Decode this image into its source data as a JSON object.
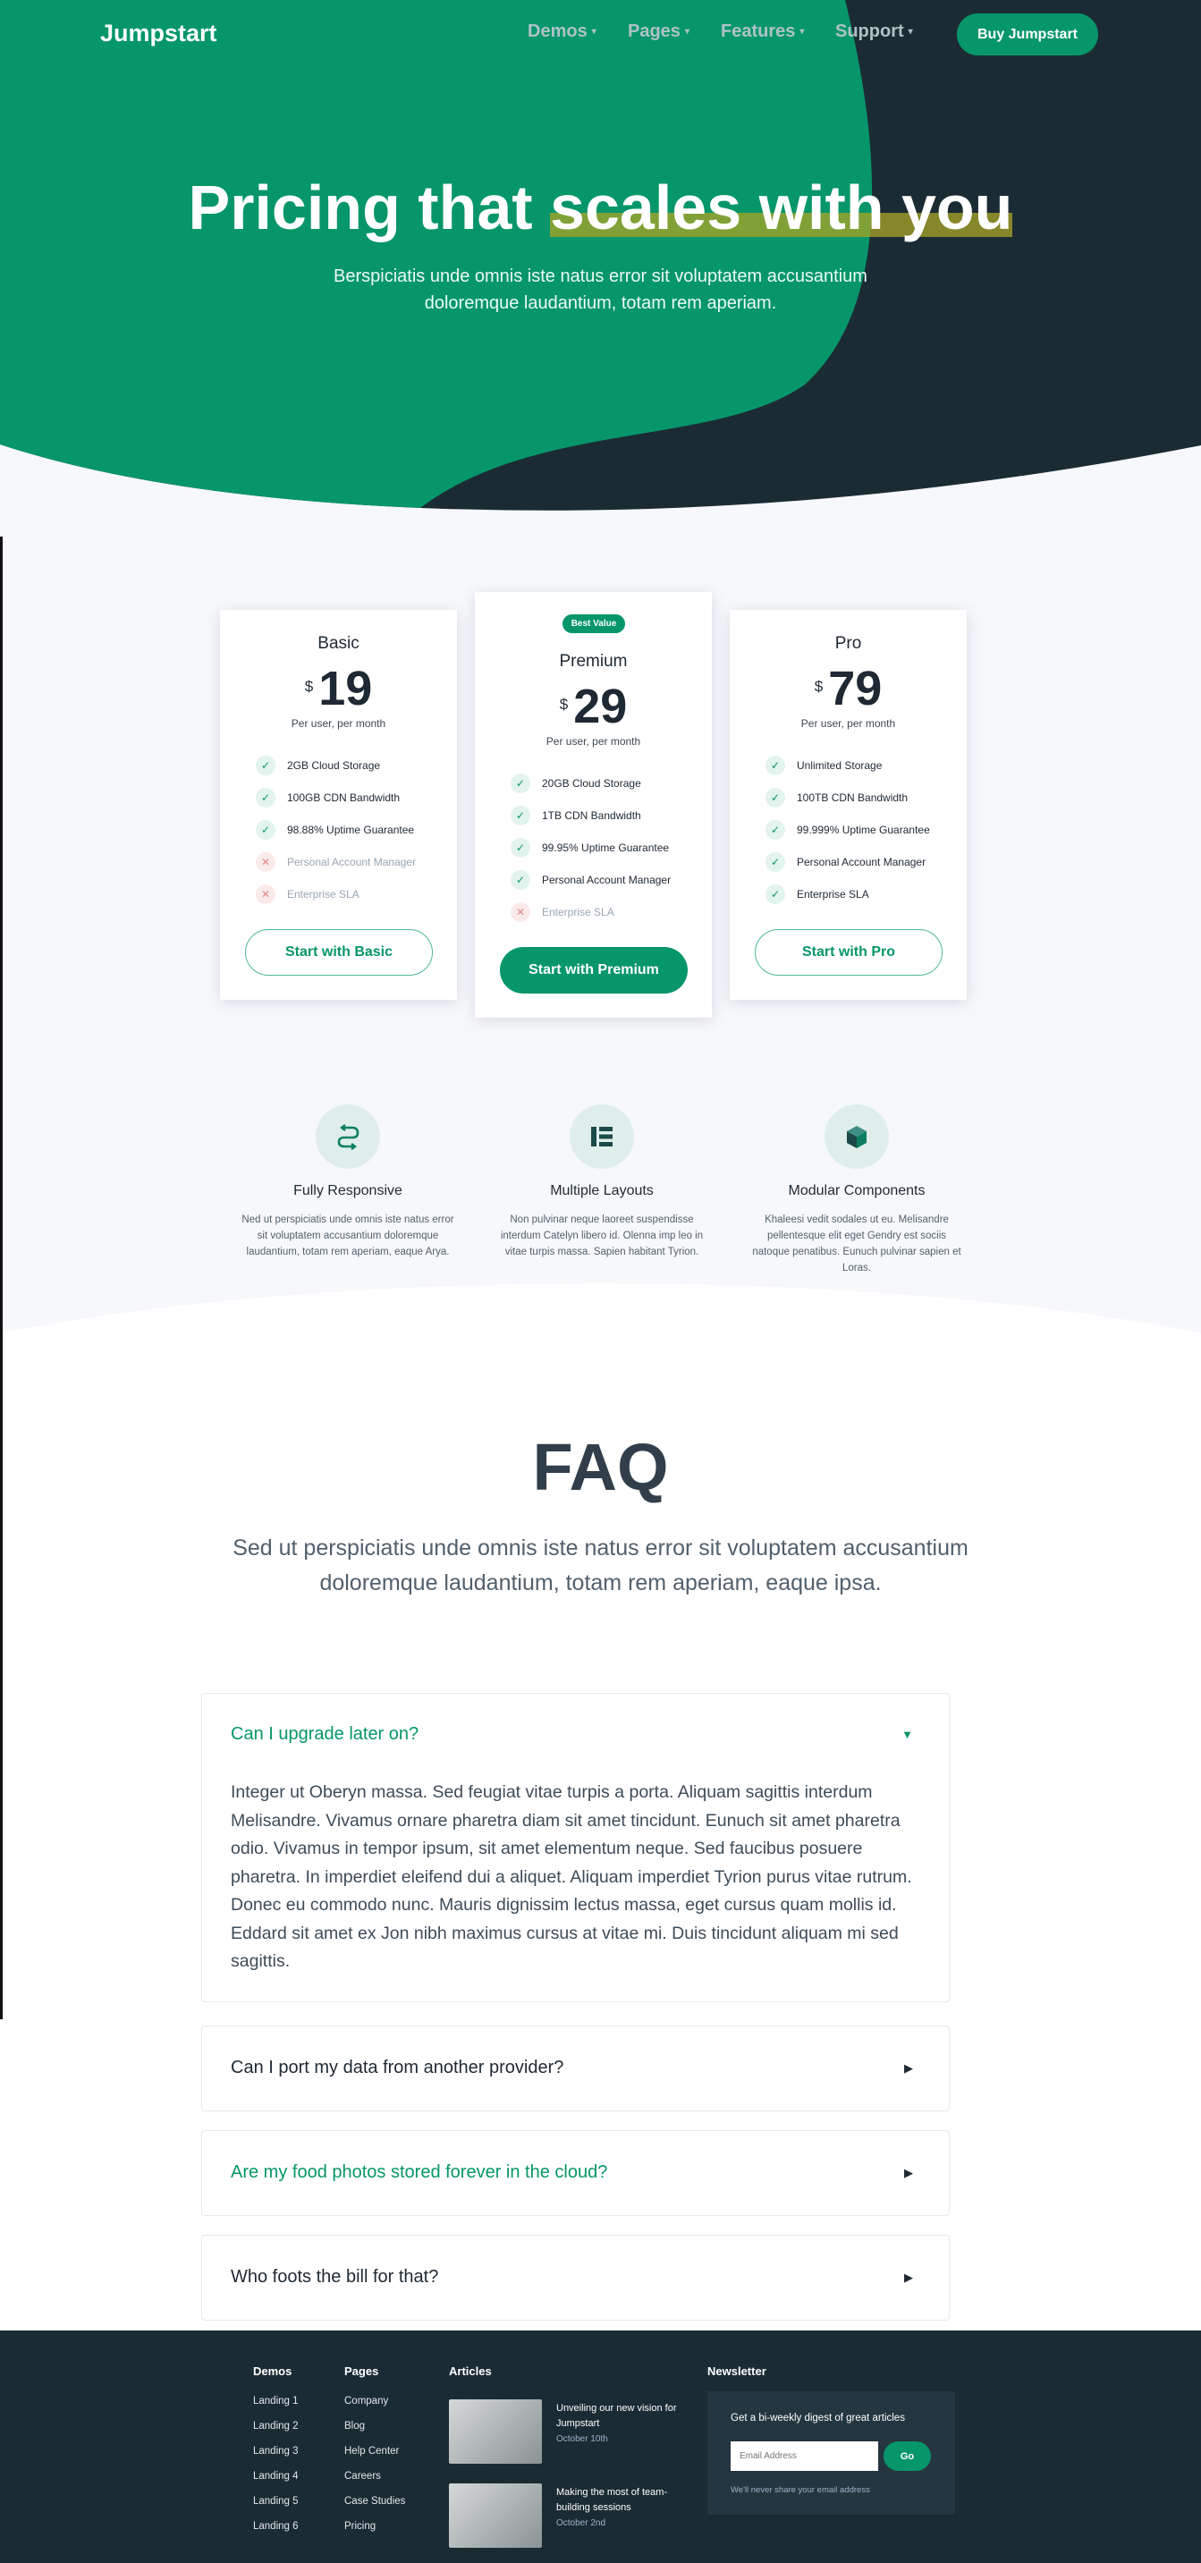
{
  "brand": {
    "logo": "Jumpstart",
    "accent": "#069669",
    "dark": "#1b2b34"
  },
  "nav": {
    "items": [
      {
        "label": "Demos",
        "caret": "▾"
      },
      {
        "label": "Pages",
        "caret": "▾"
      },
      {
        "label": "Features",
        "caret": "▾"
      },
      {
        "label": "Support",
        "caret": "▾"
      }
    ],
    "cta": "Buy Jumpstart"
  },
  "hero": {
    "title_part1": "Pricing that ",
    "title_highlight": "scales with you",
    "subtitle": "Berspiciatis unde omnis iste natus error sit voluptatem accusantium doloremque laudantium, totam rem aperiam."
  },
  "plans": [
    {
      "name": "Basic",
      "currency": "$",
      "price": "19",
      "period": "Per user, per month",
      "features": [
        {
          "text": "2GB Cloud Storage",
          "included": true,
          "icon": "check-icon",
          "mark": "✓"
        },
        {
          "text": "100GB CDN Bandwidth",
          "included": true,
          "icon": "check-icon",
          "mark": "✓"
        },
        {
          "text": "98.88% Uptime Guarantee",
          "included": true,
          "icon": "check-icon",
          "mark": "✓"
        },
        {
          "text": "Personal Account Manager",
          "included": false,
          "icon": "x-icon",
          "mark": "✕"
        },
        {
          "text": "Enterprise SLA",
          "included": false,
          "icon": "x-icon",
          "mark": "✕"
        }
      ],
      "cta": "Start with Basic"
    },
    {
      "name": "Premium",
      "badge": "Best Value",
      "currency": "$",
      "price": "29",
      "period": "Per user, per month",
      "features": [
        {
          "text": "20GB Cloud Storage",
          "included": true,
          "icon": "check-icon",
          "mark": "✓"
        },
        {
          "text": "1TB CDN Bandwidth",
          "included": true,
          "icon": "check-icon",
          "mark": "✓"
        },
        {
          "text": "99.95% Uptime Guarantee",
          "included": true,
          "icon": "check-icon",
          "mark": "✓"
        },
        {
          "text": "Personal Account Manager",
          "included": true,
          "icon": "check-icon",
          "mark": "✓"
        },
        {
          "text": "Enterprise SLA",
          "included": false,
          "icon": "x-icon",
          "mark": "✕"
        }
      ],
      "cta": "Start with Premium"
    },
    {
      "name": "Pro",
      "currency": "$",
      "price": "79",
      "period": "Per user, per month",
      "features": [
        {
          "text": "Unlimited Storage",
          "included": true,
          "icon": "check-icon",
          "mark": "✓"
        },
        {
          "text": "100TB CDN Bandwidth",
          "included": true,
          "icon": "check-icon",
          "mark": "✓"
        },
        {
          "text": "99.999% Uptime Guarantee",
          "included": true,
          "icon": "check-icon",
          "mark": "✓"
        },
        {
          "text": "Personal Account Manager",
          "included": true,
          "icon": "check-icon",
          "mark": "✓"
        },
        {
          "text": "Enterprise SLA",
          "included": true,
          "icon": "check-icon",
          "mark": "✓"
        }
      ],
      "cta": "Start with Pro"
    }
  ],
  "features": [
    {
      "icon": "responsive-icon",
      "title": "Fully Responsive",
      "text": "Ned ut perspiciatis unde omnis iste natus error sit voluptatem accusantium doloremque laudantium, totam rem aperiam, eaque Arya."
    },
    {
      "icon": "layouts-icon",
      "title": "Multiple Layouts",
      "text": "Non pulvinar neque laoreet suspendisse interdum Catelyn libero id. Olenna imp leo in vitae turpis massa. Sapien habitant Tyrion."
    },
    {
      "icon": "cube-icon",
      "title": "Modular Components",
      "text": "Khaleesi vedit sodales ut eu. Melisandre pellentesque elit eget Gendry est sociis natoque penatibus. Eunuch pulvinar sapien et Loras."
    }
  ],
  "faq": {
    "title": "FAQ",
    "subtitle": "Sed ut perspiciatis unde omnis iste natus error sit voluptatem accusantium doloremque laudantium, totam rem aperiam, eaque ipsa.",
    "items": [
      {
        "q": "Can I upgrade later on?",
        "open": true,
        "arrow": "▼",
        "color": "#069669",
        "a": "Integer ut Oberyn massa. Sed feugiat vitae turpis a porta. Aliquam sagittis interdum Melisandre. Vivamus ornare pharetra diam sit amet tincidunt. Eunuch sit amet pharetra odio. Vivamus in tempor ipsum, sit amet elementum neque. Sed faucibus posuere pharetra. In imperdiet eleifend dui a aliquet. Aliquam imperdiet Tyrion purus vitae rutrum. Donec eu commodo nunc. Mauris dignissim lectus massa, eget cursus quam mollis id. Eddard sit amet ex Jon nibh maximus cursus at vitae mi. Duis tincidunt aliquam mi sed sagittis."
      },
      {
        "q": "Can I port my data from another provider?",
        "open": false,
        "arrow": "▶",
        "color": "#1f2933"
      },
      {
        "q": "Are my food photos stored forever in the cloud?",
        "open": false,
        "arrow": "▶",
        "color": "#069669"
      },
      {
        "q": "Who foots the bill for that?",
        "open": false,
        "arrow": "▶",
        "color": "#1f2933"
      }
    ]
  },
  "footer": {
    "demos": {
      "title": "Demos",
      "links": [
        "Landing 1",
        "Landing 2",
        "Landing 3",
        "Landing 4",
        "Landing 5",
        "Landing 6"
      ]
    },
    "pages": {
      "title": "Pages",
      "links": [
        "Company",
        "Blog",
        "Help Center",
        "Careers",
        "Case Studies",
        "Pricing"
      ]
    },
    "articles": {
      "title": "Articles",
      "items": [
        {
          "title": "Unveiling our new vision for Jumpstart",
          "date": "October 10th"
        },
        {
          "title": "Making the most of team-building sessions",
          "date": "October 2nd"
        }
      ]
    },
    "newsletter": {
      "title": "Newsletter",
      "text": "Get a bi-weekly digest of great articles",
      "placeholder": "Email Address",
      "button": "Go",
      "note": "We'll never share your email address"
    }
  }
}
